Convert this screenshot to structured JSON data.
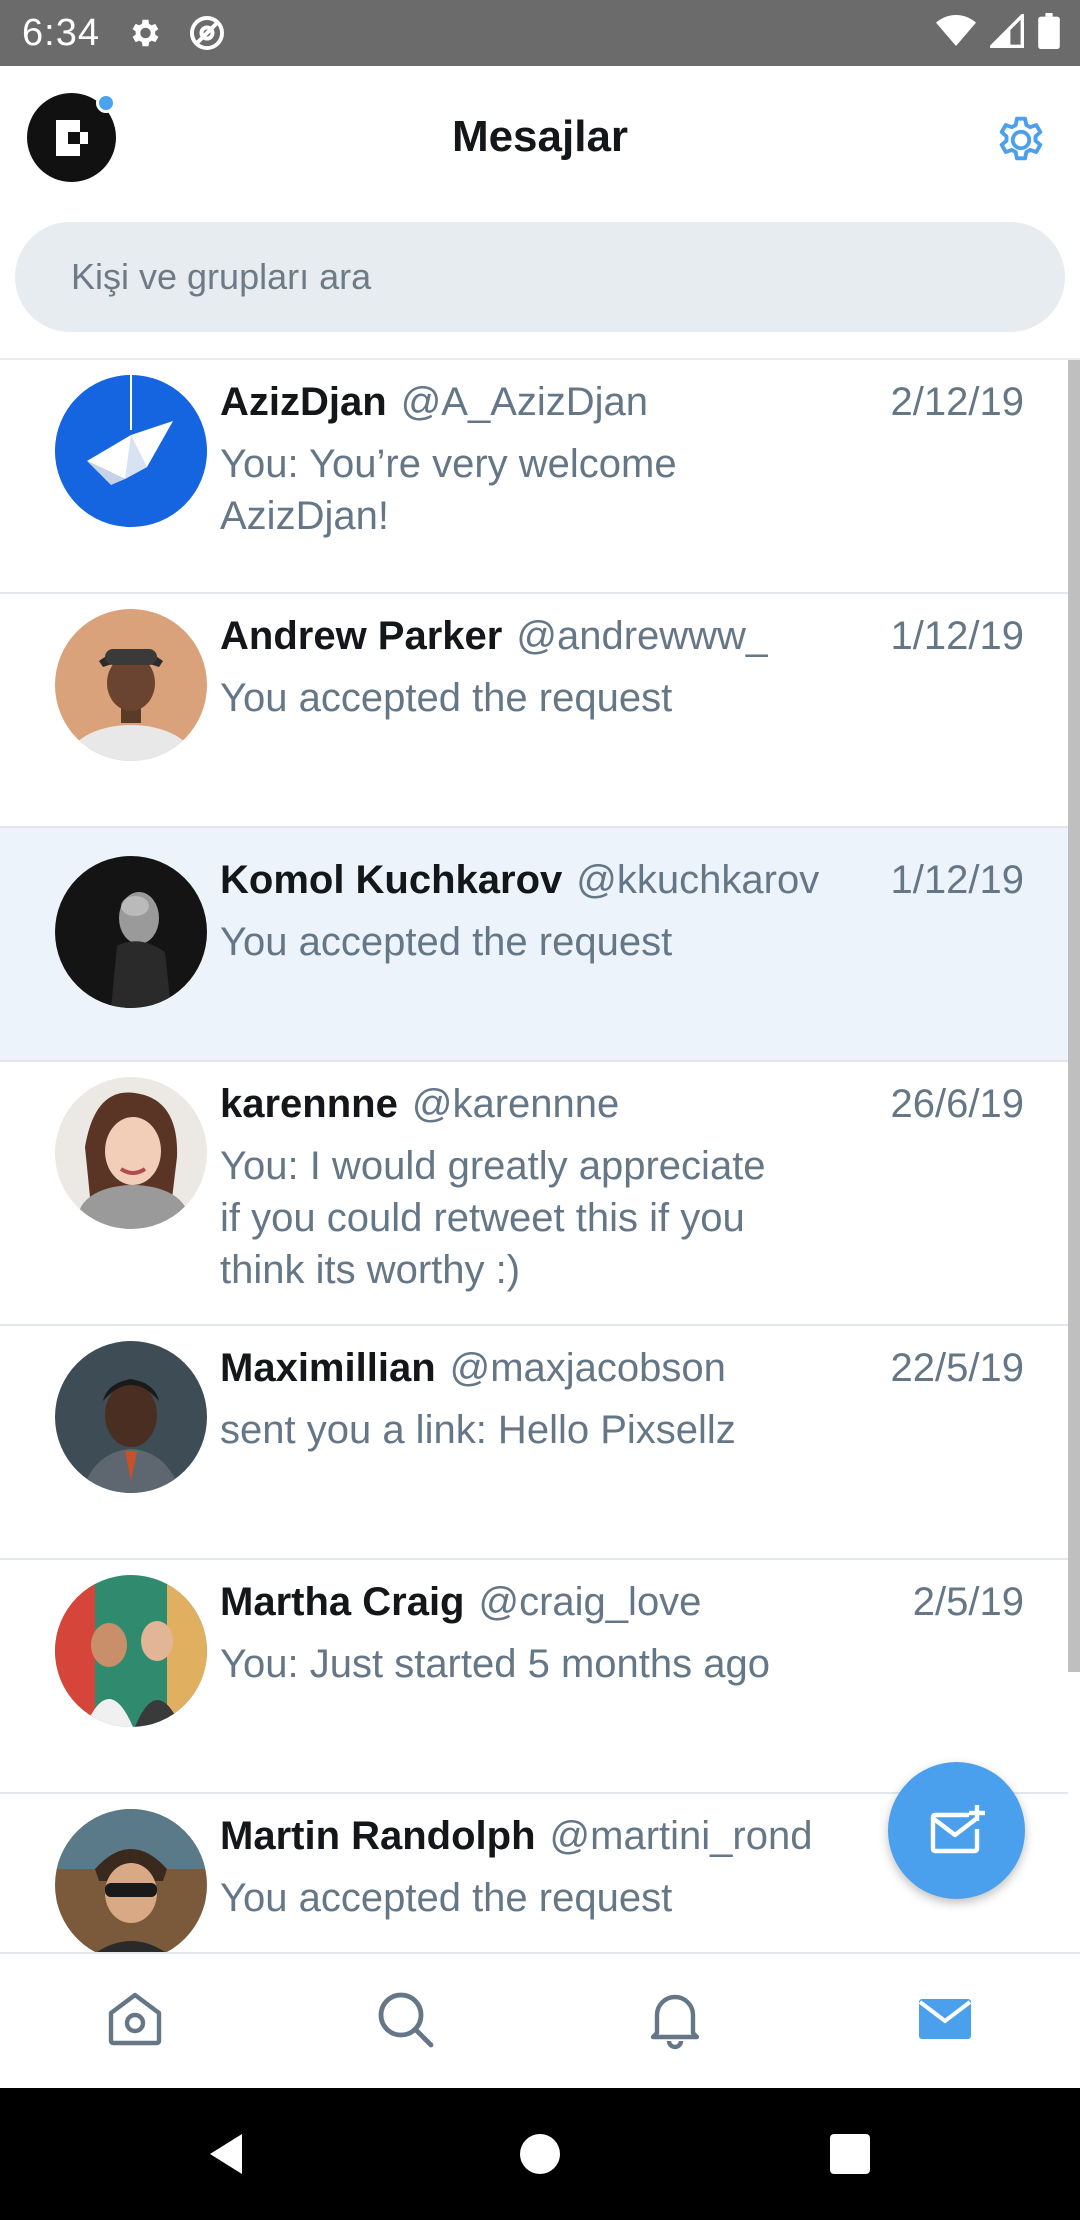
{
  "status_bar": {
    "time": "6:34",
    "left_icons": [
      "gear-icon",
      "at-sign-icon"
    ],
    "right_icons": [
      "wifi-icon",
      "signal-icon",
      "battery-icon"
    ]
  },
  "header": {
    "title": "Mesajlar",
    "logo_icon": "app-logo",
    "settings_icon": "gear-icon"
  },
  "search": {
    "placeholder": "Kişi ve grupları ara",
    "value": ""
  },
  "conversations": [
    {
      "name": "AzizDjan",
      "handle": "@A_AzizDjan",
      "date": "2/12/19",
      "preview_lines": [
        "You: You’re very welcome",
        "AzizDjan!"
      ],
      "selected": false
    },
    {
      "name": "Andrew Parker",
      "handle": "@andrewww_",
      "date": "1/12/19",
      "preview_lines": [
        "You accepted the request"
      ],
      "selected": false
    },
    {
      "name": "Komol Kuchkarov",
      "handle": "@kkuchkarov",
      "date": "1/12/19",
      "preview_lines": [
        "You accepted the request"
      ],
      "selected": true
    },
    {
      "name": "karennne",
      "handle": "@karennne",
      "date": "26/6/19",
      "preview_lines": [
        "You: I would greatly appreciate",
        "if you could retweet this if you",
        "think its worthy :)"
      ],
      "selected": false
    },
    {
      "name": "Maximillian",
      "handle": "@maxjacobson",
      "date": "22/5/19",
      "preview_lines": [
        "sent you a link: Hello Pixsellz"
      ],
      "selected": false
    },
    {
      "name": "Martha Craig",
      "handle": "@craig_love",
      "date": "2/5/19",
      "preview_lines": [
        "You: Just started 5 months ago"
      ],
      "selected": false
    },
    {
      "name": "Martin Randolph",
      "handle": "@martini_rond",
      "date": "",
      "preview_lines": [
        "You accepted the request"
      ],
      "selected": false
    }
  ],
  "fab": {
    "icon": "new-message-icon"
  },
  "bottom_nav": {
    "items": [
      {
        "icon": "home-icon",
        "active": false
      },
      {
        "icon": "search-icon",
        "active": false
      },
      {
        "icon": "bell-icon",
        "active": false
      },
      {
        "icon": "mail-icon",
        "active": true
      }
    ]
  },
  "system_nav": {
    "icons": [
      "back-icon",
      "home-circle-icon",
      "recents-icon"
    ]
  },
  "colors": {
    "accent": "#4aa0ec",
    "status_bar": "#6b6b6b",
    "search_bg": "#e6ecf0",
    "selected_row": "#edf3fb",
    "secondary_text": "#657786",
    "primary_text": "#14171a"
  }
}
